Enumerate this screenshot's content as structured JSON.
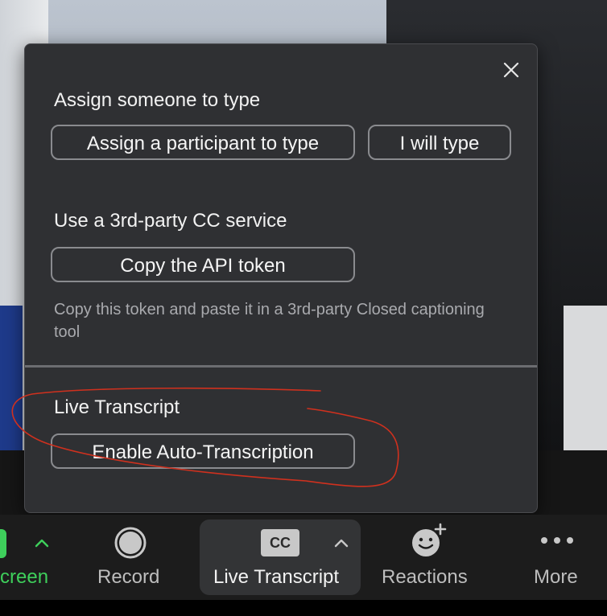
{
  "dialog": {
    "assign_section": {
      "heading": "Assign someone to type",
      "assign_participant_label": "Assign a participant to type",
      "i_will_type_label": "I will type"
    },
    "third_party_section": {
      "heading": "Use a 3rd-party CC service",
      "copy_token_label": "Copy the API token",
      "description": "Copy this token and paste it in a 3rd-party Closed captioning tool"
    },
    "live_transcript_section": {
      "heading": "Live Transcript",
      "enable_label": "Enable Auto-Transcription"
    }
  },
  "toolbar": {
    "share_screen_label": "creen",
    "record_label": "Record",
    "live_transcript_label": "Live Transcript",
    "cc_icon_text": "CC",
    "reactions_label": "Reactions",
    "more_label": "More"
  },
  "colors": {
    "panel_bg": "#2f3033",
    "annotation_red": "#d0301e",
    "share_green": "#3ecf5b",
    "toolbar_bg": "#1c1c1c"
  }
}
